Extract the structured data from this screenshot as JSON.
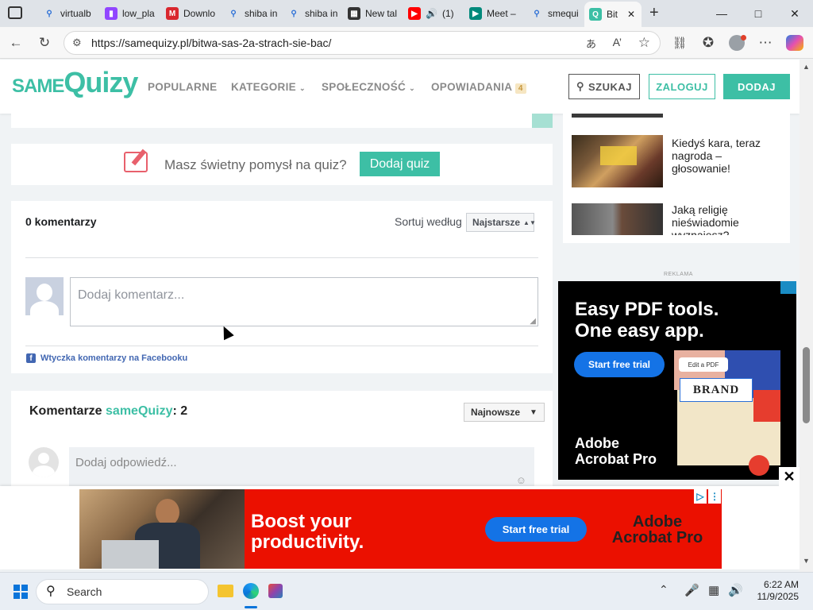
{
  "browser": {
    "tabs": [
      {
        "label": "virtualb",
        "icon": "search-icon",
        "color": "#2b6fd6"
      },
      {
        "label": "low_pla",
        "icon": "twitch-icon",
        "color": "#9146ff"
      },
      {
        "label": "Downlo",
        "icon": "mega-icon",
        "color": "#d9272e"
      },
      {
        "label": "shiba in",
        "icon": "search-icon",
        "color": "#2b6fd6"
      },
      {
        "label": "shiba in",
        "icon": "search-icon",
        "color": "#2b6fd6"
      },
      {
        "label": "New tal",
        "icon": "newtab-icon",
        "color": "#333333"
      },
      {
        "label": "(1)",
        "icon": "youtube-icon",
        "color": "#ff0000"
      },
      {
        "label": "Meet –",
        "icon": "meet-icon",
        "color": "#00897b"
      },
      {
        "label": "smequi",
        "icon": "search-icon",
        "color": "#2b6fd6"
      },
      {
        "label": "Bit",
        "icon": "samequizy-icon",
        "color": "#3dbfa5"
      }
    ],
    "url": "https://samequizy.pl/bitwa-sas-2a-strach-sie-bac/"
  },
  "header": {
    "logo_same": "SAME",
    "logo_quizy": "Quizy",
    "nav": [
      "POPULARNE",
      "KATEGORIE",
      "SPOŁECZNOŚĆ",
      "OPOWIADANIA"
    ],
    "opowiadania_badge": "4",
    "search_label": "SZUKAJ",
    "login_label": "ZALOGUJ",
    "add_label": "DODAJ"
  },
  "idea": {
    "text": "Masz świetny pomysł na quiz?",
    "button": "Dodaj quiz"
  },
  "fb_comments": {
    "count_label": "0 komentarzy",
    "sort_label": "Sortuj według",
    "sort_value": "Najstarsze",
    "placeholder": "Dodaj komentarz...",
    "plugin_label": "Wtyczka komentarzy na Facebooku"
  },
  "site_comments": {
    "title_prefix": "Komentarze ",
    "title_brand": "sameQuizy",
    "title_suffix": ": 2",
    "sort_value": "Najnowsze",
    "reply_placeholder": "Dodaj odpowiedź..."
  },
  "sidebar": {
    "items": [
      {
        "title": "Kiedyś kara, teraz nagroda – głosowanie!"
      },
      {
        "title": "Jaką religię nieświadomie wyznajesz?"
      }
    ],
    "ad_label": "REKLAMA"
  },
  "ad_side": {
    "headline1": "Easy PDF tools.",
    "headline2": "One easy app.",
    "cta": "Start free trial",
    "chip": "Edit a PDF",
    "brand_word": "BRAND",
    "product1": "Adobe",
    "product2": "Acrobat Pro"
  },
  "ad_bottom": {
    "headline1": "Boost your",
    "headline2": "productivity.",
    "cta": "Start free trial",
    "product1": "Adobe",
    "product2": "Acrobat Pro"
  },
  "taskbar": {
    "search_placeholder": "Search",
    "time": "6:22 AM",
    "date": "11/9/2025"
  },
  "colors": {
    "accent": "#3dbfa5",
    "ad_red": "#eb1000",
    "ad_blue": "#1473e6"
  }
}
